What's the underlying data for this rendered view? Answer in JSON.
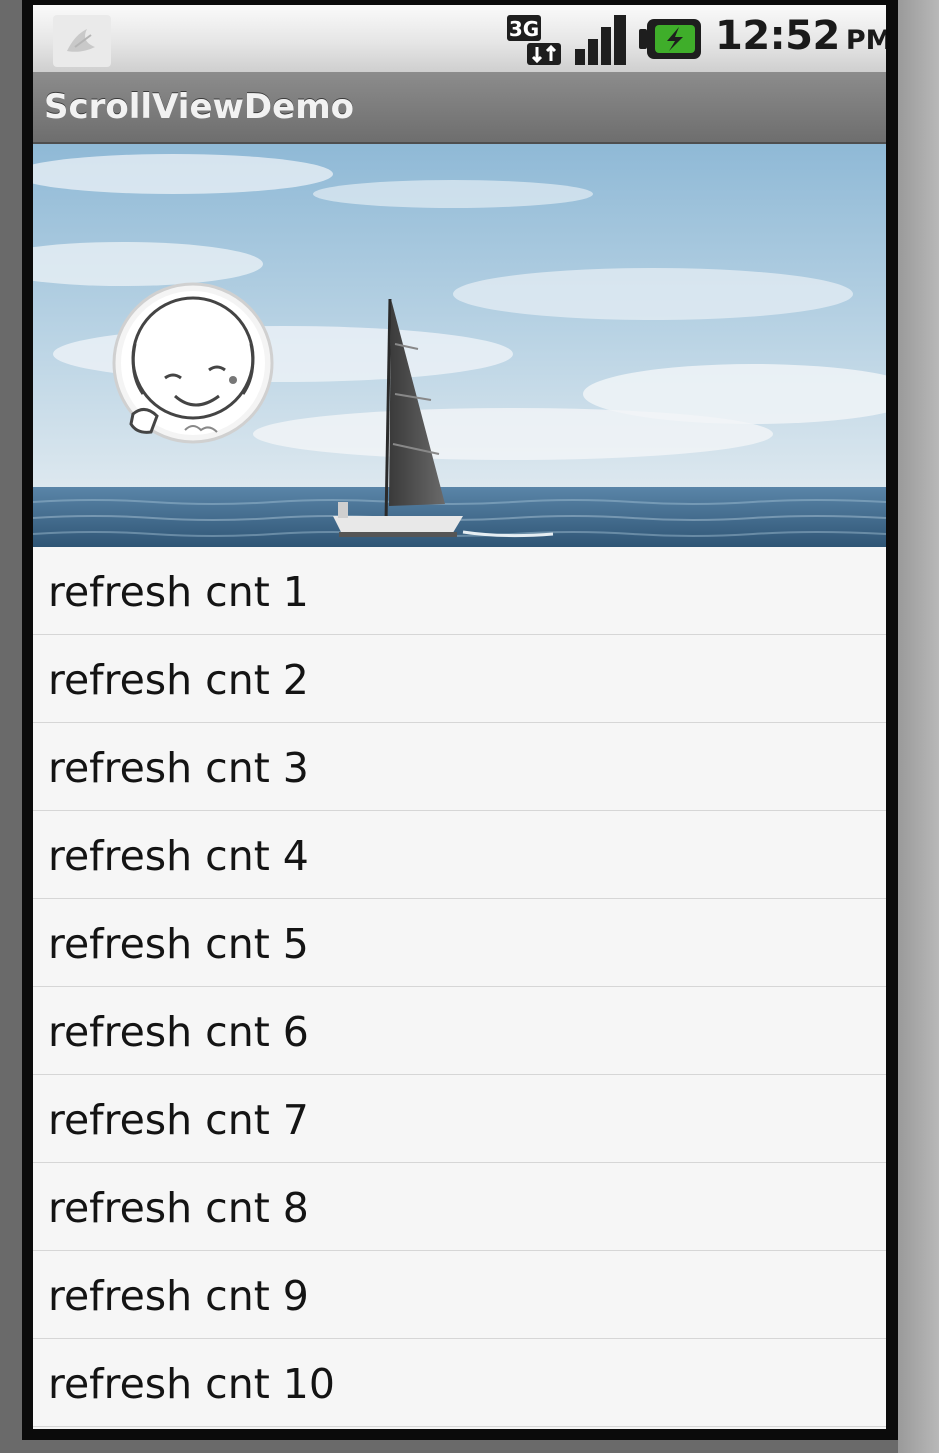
{
  "status_bar": {
    "network": "3G",
    "time": "12:52",
    "ampm": "PM",
    "icons": [
      "notification-bird-icon",
      "network-3g-icon",
      "signal-strength-icon",
      "battery-charging-icon"
    ]
  },
  "app": {
    "title": "ScrollViewDemo"
  },
  "hero": {
    "image": "sailboat-on-sea-photo",
    "avatar": "cartoon-face-avatar"
  },
  "list": {
    "items": [
      {
        "label": "refresh cnt 1"
      },
      {
        "label": "refresh cnt 2"
      },
      {
        "label": "refresh cnt 3"
      },
      {
        "label": "refresh cnt 4"
      },
      {
        "label": "refresh cnt 5"
      },
      {
        "label": "refresh cnt 6"
      },
      {
        "label": "refresh cnt 7"
      },
      {
        "label": "refresh cnt 8"
      },
      {
        "label": "refresh cnt 9"
      },
      {
        "label": "refresh cnt 10"
      }
    ]
  },
  "colors": {
    "titlebar": "#7a7a7a",
    "list_background": "#f6f6f6",
    "battery_accent": "#3fae2a",
    "sky": "#a8c8de",
    "sea": "#3d6a8f"
  }
}
